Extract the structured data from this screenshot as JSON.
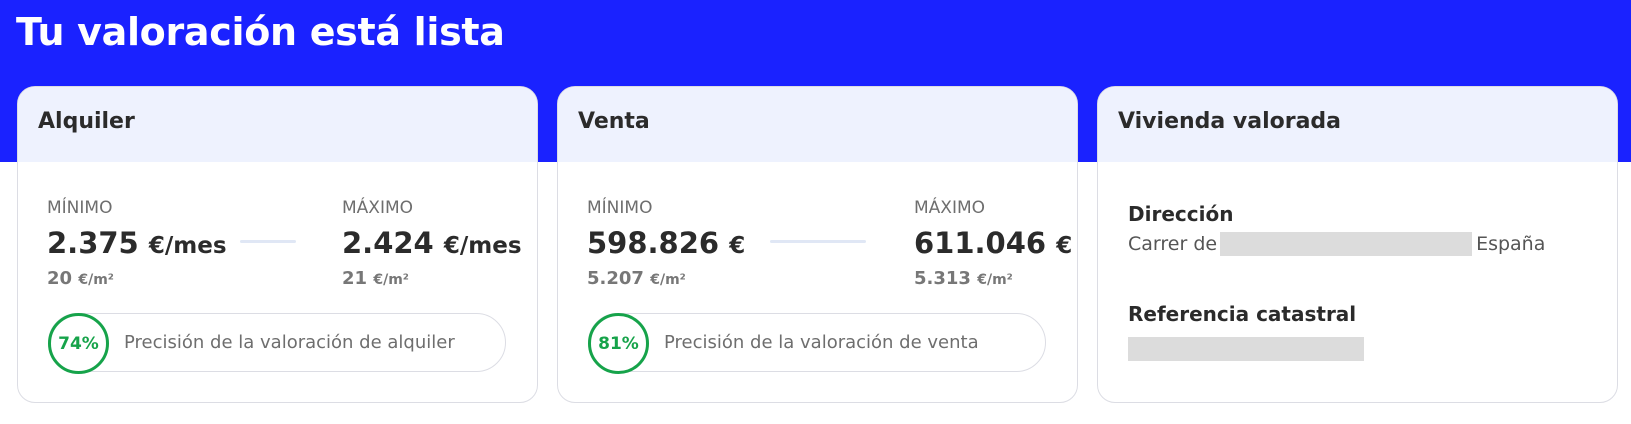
{
  "page": {
    "title": "Tu valoración está lista"
  },
  "rent": {
    "title": "Alquiler",
    "min": {
      "label": "MÍNIMO",
      "value": "2.375",
      "unit": "€/mes",
      "sqm": "20",
      "sqm_unit": "€/m²"
    },
    "max": {
      "label": "MÁXIMO",
      "value": "2.424",
      "unit": "€/mes",
      "sqm": "21",
      "sqm_unit": "€/m²"
    },
    "precision": {
      "percent": "74%",
      "text": "Precisión de la valoración de alquiler"
    }
  },
  "sale": {
    "title": "Venta",
    "min": {
      "label": "MÍNIMO",
      "value": "598.826",
      "unit": "€",
      "sqm": "5.207",
      "sqm_unit": "€/m²"
    },
    "max": {
      "label": "MÁXIMO",
      "value": "611.046",
      "unit": "€",
      "sqm": "5.313",
      "sqm_unit": "€/m²"
    },
    "precision": {
      "percent": "81%",
      "text": "Precisión de la valoración de venta"
    }
  },
  "property": {
    "title": "Vivienda valorada",
    "address_label": "Dirección",
    "address_prefix": "Carrer de",
    "address_suffix": "España",
    "cadastral_label": "Referencia catastral"
  },
  "colors": {
    "banner": "#1a22ff",
    "header": "#eef2fe",
    "precision": "#16a34a"
  }
}
